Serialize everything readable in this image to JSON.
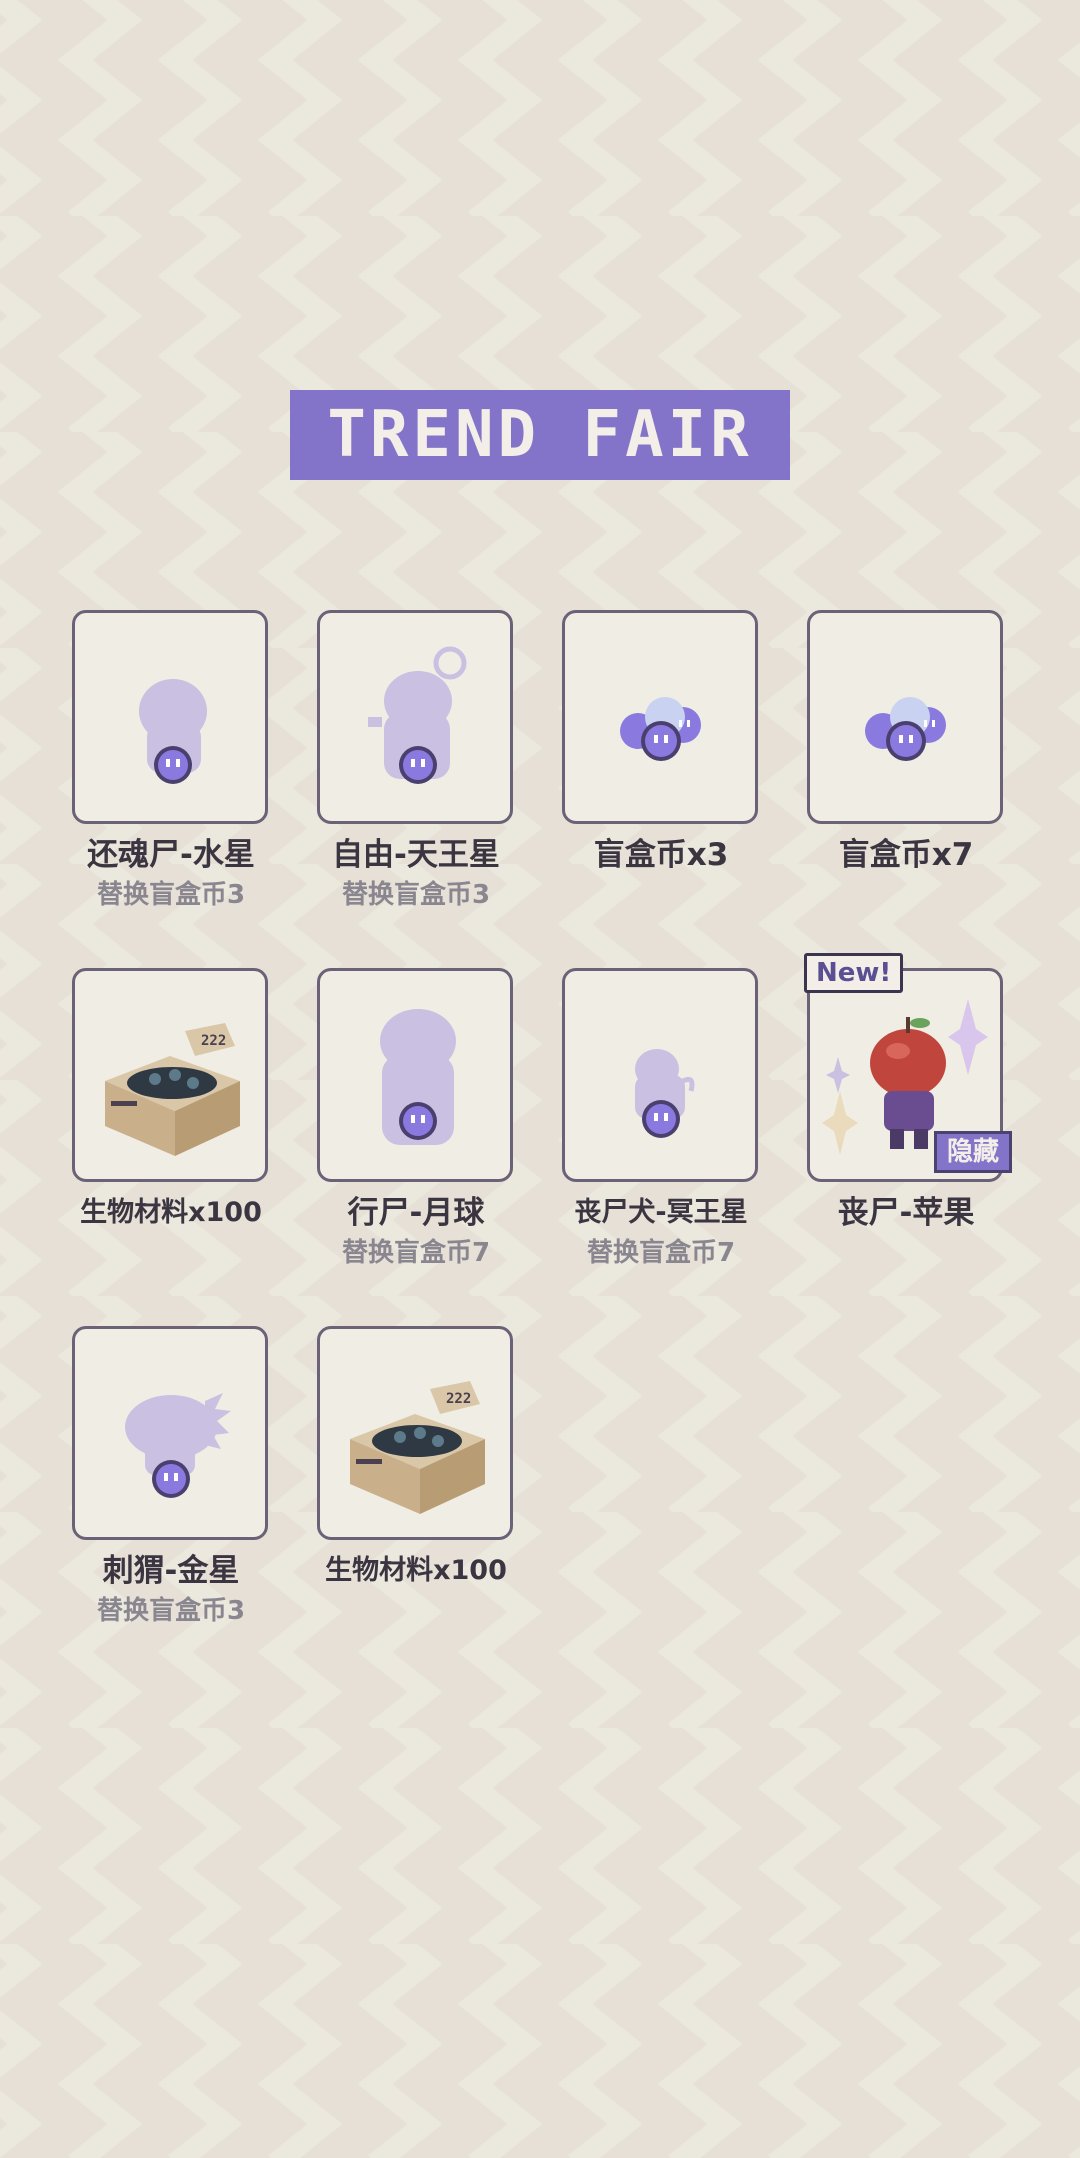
{
  "banner": {
    "title": "TREND FAIR"
  },
  "colors": {
    "background": "#e6e0d6",
    "zigzag": "#ebe8dd",
    "accent": "#8474c9",
    "card_bg": "#f0ede4",
    "card_border": "#6b6278"
  },
  "items": [
    {
      "name": "还魂尸-水星",
      "sub": "替换盲盒币3",
      "icon": "zombie-silhouette-icon"
    },
    {
      "name": "自由-天王星",
      "sub": "替换盲盒币3",
      "icon": "zombie-ring-silhouette-icon"
    },
    {
      "name": "盲盒币x3",
      "sub": "",
      "icon": "coins-icon"
    },
    {
      "name": "盲盒币x7",
      "sub": "",
      "icon": "coins-icon"
    },
    {
      "name": "生物材料x100",
      "sub": "",
      "icon": "material-box-icon"
    },
    {
      "name": "行尸-月球",
      "sub": "替换盲盒币7",
      "icon": "zombie-silhouette-icon"
    },
    {
      "name": "丧尸犬-冥王星",
      "sub": "替换盲盒币7",
      "icon": "zombie-dog-silhouette-icon"
    },
    {
      "name": "丧尸-苹果",
      "sub": "",
      "icon": "apple-zombie-icon",
      "new_label": "New!",
      "hidden_label": "隐藏"
    },
    {
      "name": "刺猬-金星",
      "sub": "替换盲盒币3",
      "icon": "hedgehog-silhouette-icon"
    },
    {
      "name": "生物材料x100",
      "sub": "",
      "icon": "material-box-icon"
    }
  ]
}
